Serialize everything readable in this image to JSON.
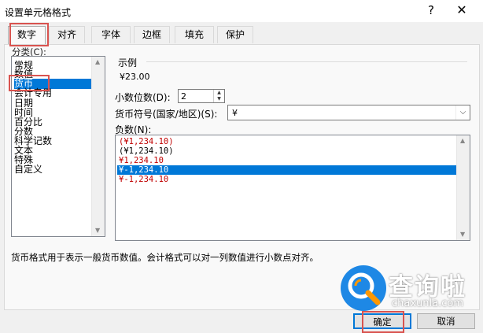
{
  "window": {
    "title": "设置单元格格式",
    "help_label": "?",
    "close_label": "✕"
  },
  "tabs": [
    {
      "label": "数字",
      "active": true
    },
    {
      "label": "对齐"
    },
    {
      "label": "字体"
    },
    {
      "label": "边框"
    },
    {
      "label": "填充"
    },
    {
      "label": "保护"
    }
  ],
  "category": {
    "label": "分类(C):",
    "items": [
      "常规",
      "数值",
      "货币",
      "会计专用",
      "日期",
      "时间",
      "百分比",
      "分数",
      "科学记数",
      "文本",
      "特殊",
      "自定义"
    ],
    "selected": "货币"
  },
  "sample": {
    "label": "示例",
    "value": "¥23.00"
  },
  "decimals": {
    "label": "小数位数(D):",
    "value": "2"
  },
  "currency": {
    "label": "货币符号(国家/地区)(S):",
    "value": "¥"
  },
  "negative": {
    "label": "负数(N):",
    "items": [
      {
        "text": "(¥1,234.10)",
        "style": "red"
      },
      {
        "text": "(¥1,234.10)",
        "style": "black"
      },
      {
        "text": "¥1,234.10",
        "style": "red"
      },
      {
        "text": "¥-1,234.10",
        "style": "selected"
      },
      {
        "text": "¥-1,234.10",
        "style": "red"
      }
    ]
  },
  "description": "货币格式用于表示一般货币数值。会计格式可以对一列数值进行小数点对齐。",
  "buttons": {
    "ok": "确定",
    "cancel": "取消"
  },
  "watermark": {
    "name": "查询啦",
    "domain": "chaxunla.com"
  },
  "colors": {
    "selection": "#0078d7",
    "negative_red": "#c00000",
    "highlight": "#d9534f",
    "watermark_blue": "#1e88e5",
    "watermark_orange": "#ff9800"
  }
}
